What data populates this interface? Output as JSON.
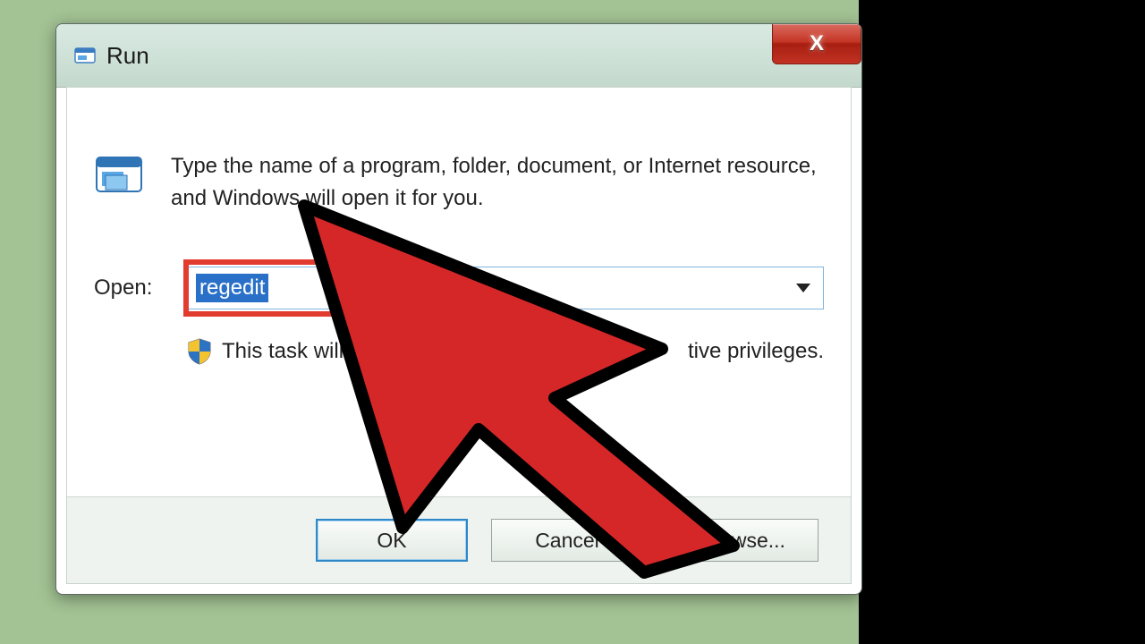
{
  "window": {
    "title": "Run",
    "close_glyph": "X"
  },
  "body": {
    "description": "Type the name of a program, folder, document, or Internet resource, and Windows will open it for you.",
    "open_label": "Open:",
    "open_value": "regedit",
    "privilege_prefix": "This task will b",
    "privilege_suffix": "tive privileges."
  },
  "buttons": {
    "ok": "OK",
    "cancel": "Cancel",
    "browse": "Browse..."
  },
  "colors": {
    "desktop": "#a3c394",
    "highlight": "#e23b2f",
    "arrow": "#d62728",
    "selection": "#2a70c8"
  },
  "annotation": {
    "type": "large-cursor-arrow",
    "direction": "upper-left"
  }
}
